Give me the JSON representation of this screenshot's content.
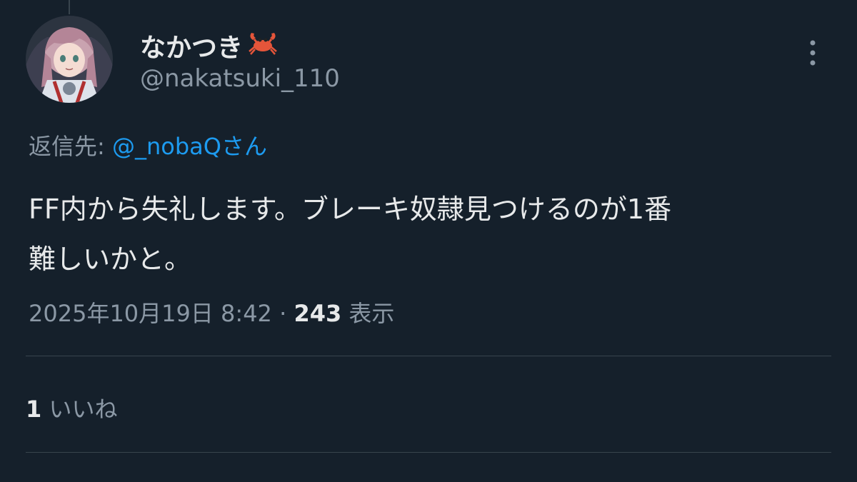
{
  "author": {
    "display_name": "なかつき",
    "emoji_icon": "crab-icon",
    "handle": "@nakatsuki_110",
    "avatar_icon": "anime-girl-avatar"
  },
  "more_icon": "more-vertical-icon",
  "reply": {
    "prefix": "返信先: ",
    "mention": "@_nobaQ",
    "suffix": "さん"
  },
  "tweet": {
    "line1": "FF内から失礼します。ブレーキ奴隷見つけるのが1番",
    "line2": "難しいかと。"
  },
  "meta": {
    "datetime": "2025年10月19日 8:42",
    "separator": " · ",
    "views_count": "243",
    "views_label": " 表示"
  },
  "engagement": {
    "like_count": "1",
    "like_label": " いいね"
  },
  "colors": {
    "background": "#15202b",
    "primary_text": "#e7e9ea",
    "secondary_text": "#8b98a5",
    "link": "#1d9bf0",
    "divider": "#38444d"
  }
}
